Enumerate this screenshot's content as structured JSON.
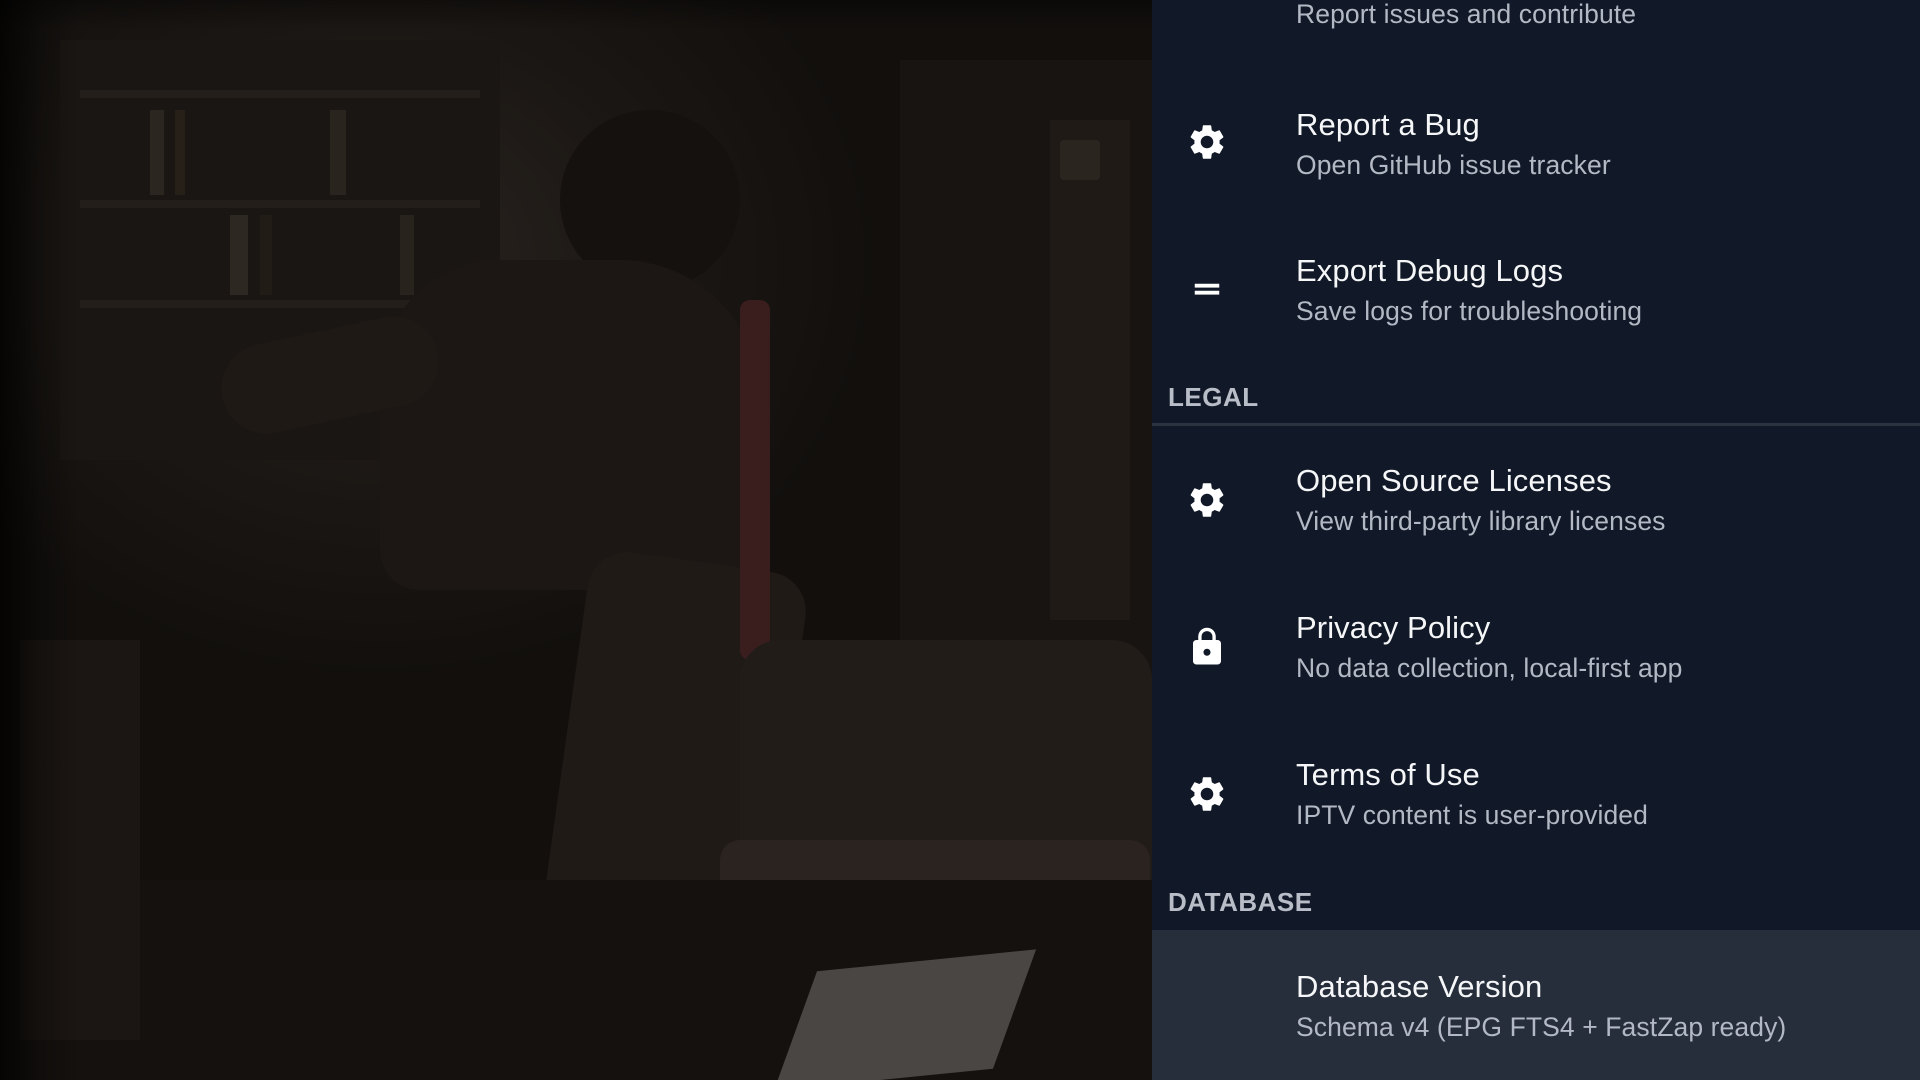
{
  "panel": {
    "partial_top_item": {
      "subtitle": "Report issues and contribute",
      "icon": "menu-lines-icon"
    },
    "items": [
      {
        "title": "Report a Bug",
        "subtitle": "Open GitHub issue tracker",
        "icon": "gear-icon"
      },
      {
        "title": "Export Debug Logs",
        "subtitle": "Save logs for troubleshooting",
        "icon": "equals-icon"
      }
    ],
    "sections": [
      {
        "header": "LEGAL",
        "items": [
          {
            "title": "Open Source Licenses",
            "subtitle": "View third-party library licenses",
            "icon": "gear-icon"
          },
          {
            "title": "Privacy Policy",
            "subtitle": "No data collection, local-first app",
            "icon": "lock-icon"
          },
          {
            "title": "Terms of Use",
            "subtitle": "IPTV content is user-provided",
            "icon": "gear-icon"
          }
        ]
      },
      {
        "header": "DATABASE",
        "items": [
          {
            "title": "Database Version",
            "subtitle": "Schema v4 (EPG FTS4 + FastZap ready)",
            "icon": "none",
            "focused": true
          }
        ]
      }
    ]
  },
  "colors": {
    "panel_bg": "#111827",
    "focused_row_bg": "#262d3b",
    "title_text": "#f5f6f8",
    "subtitle_text": "#b3b9c4",
    "section_header_text": "#b8bdc7"
  }
}
